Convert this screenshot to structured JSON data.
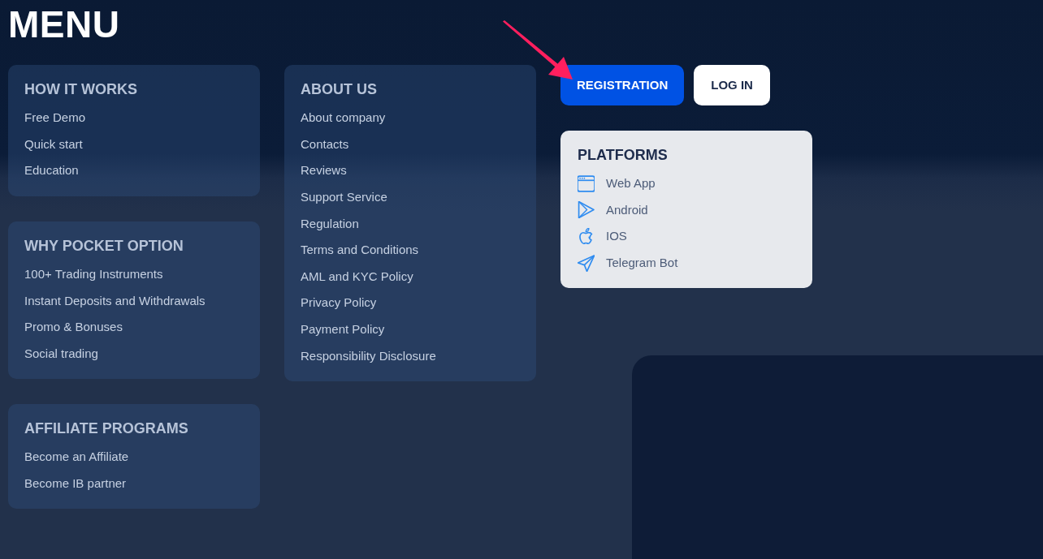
{
  "title": "MENU",
  "menu_columns": [
    [
      {
        "heading": "HOW IT WORKS",
        "items": [
          "Free Demo",
          "Quick start",
          "Education"
        ]
      },
      {
        "heading": "WHY POCKET OPTION",
        "items": [
          "100+ Trading Instruments",
          "Instant Deposits and Withdrawals",
          "Promo & Bonuses",
          "Social trading"
        ]
      },
      {
        "heading": "AFFILIATE PROGRAMS",
        "items": [
          "Become an Affiliate",
          "Become IB partner"
        ]
      }
    ],
    [
      {
        "heading": "ABOUT US",
        "items": [
          "About company",
          "Contacts",
          "Reviews",
          "Support Service",
          "Regulation",
          "Terms and Conditions",
          "AML and KYC Policy",
          "Privacy Policy",
          "Payment Policy",
          "Responsibility Disclosure"
        ]
      }
    ]
  ],
  "auth_buttons": [
    {
      "label": "REGISTRATION",
      "kind": "primary"
    },
    {
      "label": "LOG IN",
      "kind": "secondary"
    }
  ],
  "platforms": {
    "heading": "PLATFORMS",
    "items": [
      {
        "label": "Web App",
        "kind": "web"
      },
      {
        "label": "Android",
        "kind": "android"
      },
      {
        "label": "IOS",
        "kind": "ios"
      },
      {
        "label": "Telegram Bot",
        "kind": "telegram"
      }
    ]
  },
  "annotation_arrow": true
}
